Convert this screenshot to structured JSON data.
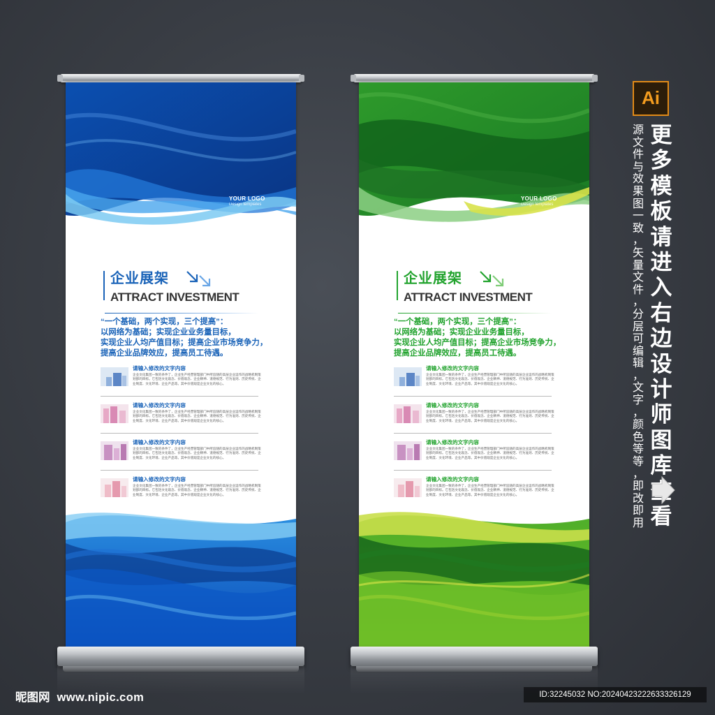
{
  "banners": [
    {
      "theme": "blue",
      "colors": {
        "accent": "#1a63b8",
        "dark": "#0a3a8c",
        "mid": "#1a5fc4",
        "light": "#5ab8ee"
      },
      "logo": {
        "line1": "YOUR LOGO",
        "line2": "Design templates"
      },
      "title_cn": "企业展架",
      "title_en": "ATTRACT INVESTMENT",
      "slogan": [
        "“一个基础，两个实现，三个提高”：",
        "以网络为基础；实现企业业务量目标，",
        "实现企业人均产值目标；提高企业市场竞争力，",
        "提高企业品牌效应，提高员工待遇。"
      ],
      "items": [
        {
          "title": "请输入修改的文字内容",
          "desc": "企业文化集团一致的条件了，企业生产经营管理部门中所追随的高层企业运作的战略机制策划部的目标。它包括文化观念、价值观念、企业精神、道德规范、行为准则、历史传统、企业制度、文化环境、企业产品等。其中价值观是企业文化的核心。"
        },
        {
          "title": "请输入修改的文字内容",
          "desc": "企业文化集团一致的条件了，企业生产经营管理部门中所追随的高层企业运作的战略机制策划部的目标。它包括文化观念、价值观念、企业精神、道德规范、行为准则、历史传统、企业制度、文化环境、企业产品等。其中价值观是企业文化的核心。"
        },
        {
          "title": "请输入修改的文字内容",
          "desc": "企业文化集团一致的条件了，企业生产经营管理部门中所追随的高层企业运作的战略机制策划部的目标。它包括文化观念、价值观念、企业精神、道德规范、行为准则、历史传统、企业制度、文化环境、企业产品等。其中价值观是企业文化的核心。"
        },
        {
          "title": "请输入修改的文字内容",
          "desc": "企业文化集团一致的条件了，企业生产经营管理部门中所追随的高层企业运作的战略机制策划部的目标。它包括文化观念、价值观念、企业精神、道德规范、行为准则、历史传统、企业制度、文化环境、企业产品等。其中价值观是企业文化的核心。"
        }
      ]
    },
    {
      "theme": "green",
      "colors": {
        "accent": "#22a32e",
        "dark": "#0f5e1a",
        "mid": "#2f9e2c",
        "light": "#b9d82a"
      },
      "logo": {
        "line1": "YOUR LOGO",
        "line2": "Design templates"
      },
      "title_cn": "企业展架",
      "title_en": "ATTRACT INVESTMENT",
      "slogan": [
        "“一个基础，两个实现，三个提高”：",
        "以网络为基础；实现企业业务量目标，",
        "实现企业人均产值目标；提高企业市场竞争力，",
        "提高企业品牌效应，提高员工待遇。"
      ],
      "items": [
        {
          "title": "请输入修改的文字内容",
          "desc": "企业文化集团一致的条件了，企业生产经营管理部门中所追随的高层企业运作的战略机制策划部的目标。它包括文化观念、价值观念、企业精神、道德规范、行为准则、历史传统、企业制度、文化环境、企业产品等。其中价值观是企业文化的核心。"
        },
        {
          "title": "请输入修改的文字内容",
          "desc": "企业文化集团一致的条件了，企业生产经营管理部门中所追随的高层企业运作的战略机制策划部的目标。它包括文化观念、价值观念、企业精神、道德规范、行为准则、历史传统、企业制度、文化环境、企业产品等。其中价值观是企业文化的核心。"
        },
        {
          "title": "请输入修改的文字内容",
          "desc": "企业文化集团一致的条件了，企业生产经营管理部门中所追随的高层企业运作的战略机制策划部的目标。它包括文化观念、价值观念、企业精神、道德规范、行为准则、历史传统、企业制度、文化环境、企业产品等。其中价值观是企业文化的核心。"
        },
        {
          "title": "请输入修改的文字内容",
          "desc": "企业文化集团一致的条件了，企业生产经营管理部门中所追随的高层企业运作的战略机制策划部的目标。它包括文化观念、价值观念、企业精神、道德规范、行为准则、历史传统、企业制度、文化环境、企业产品等。其中价值观是企业文化的核心。"
        }
      ]
    }
  ],
  "promo": {
    "badge": "Ai",
    "badge_color": "#f39c1f",
    "small_text": "源文件与效果图一致，矢量文件，分层可编辑，文字，颜色等等，即改即用",
    "big_text": "更多模板请进入右边设计师图库查看",
    "arrow_icon": "right-arrow-icon"
  },
  "footer": {
    "site_name": "昵图网",
    "site_url": "www.nipic.com",
    "id_text": "ID:32245032 NO:20240423222633326129"
  }
}
